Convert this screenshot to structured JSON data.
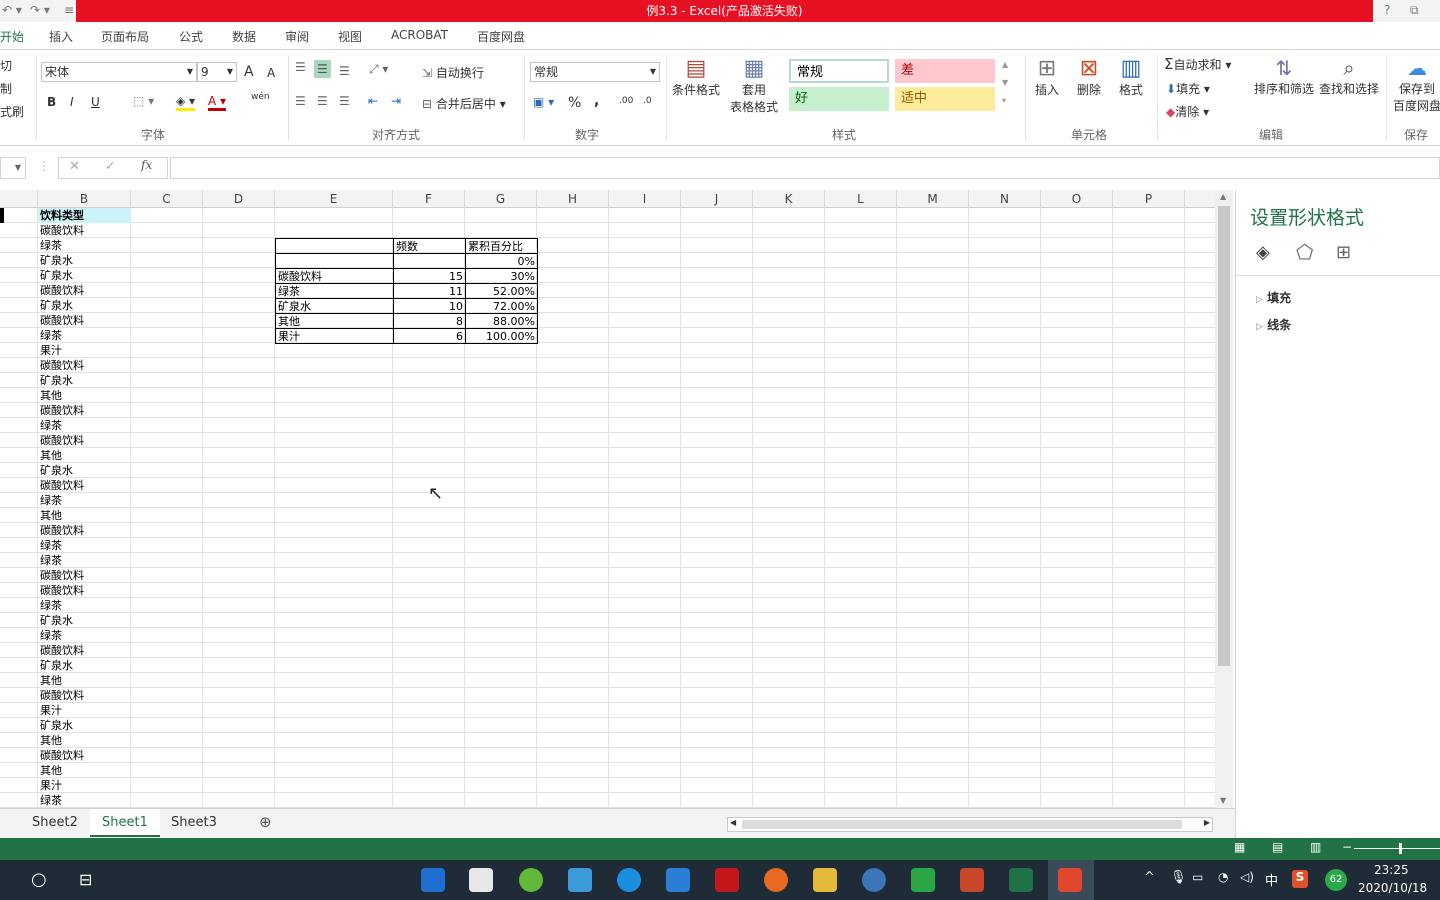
{
  "title": "例3.3 -  Excel(产品激活失败)",
  "window_buttons": {
    "help": "?",
    "restore": "⧉"
  },
  "tabs": [
    {
      "label": "开始",
      "active": true
    },
    {
      "label": "插入"
    },
    {
      "label": "页面布局"
    },
    {
      "label": "公式"
    },
    {
      "label": "数据"
    },
    {
      "label": "审阅"
    },
    {
      "label": "视图"
    },
    {
      "label": "ACROBAT"
    },
    {
      "label": "百度网盘"
    }
  ],
  "ribbon": {
    "clipboard": {
      "cut": "切",
      "copy": "制",
      "painter": "式刷"
    },
    "font": {
      "name": "宋体",
      "size": "9",
      "label": "字体",
      "bold": "B",
      "italic": "I",
      "underline": "U",
      "grow": "A",
      "shrink": "A",
      "phonetic": "wén"
    },
    "alignment": {
      "wrap": "自动换行",
      "merge": "合并后居中",
      "label": "对齐方式"
    },
    "number": {
      "format": "常规",
      "percent": "%",
      "comma": ",",
      "inc": ".00",
      "dec": ".0",
      "label": "数字"
    },
    "styles": {
      "conditional": "条件格式",
      "table_a": "套用",
      "table_b": "表格格式",
      "normal": "常规",
      "bad": "差",
      "good": "好",
      "neutral": "适中",
      "label": "样式"
    },
    "cells": {
      "insert": "插入",
      "delete": "删除",
      "format": "格式",
      "label": "单元格"
    },
    "editing": {
      "autosum": "自动求和",
      "fill": "填充",
      "clear": "清除",
      "sort": "排序和筛选",
      "find": "查找和选择",
      "label": "编辑"
    },
    "save": {
      "line1": "保存到",
      "line2": "百度网盘",
      "label": "保存"
    }
  },
  "formula_bar": {
    "fx": "fx",
    "cancel": "✕",
    "enter": "✓",
    "value": ""
  },
  "columns": [
    "B",
    "C",
    "D",
    "E",
    "F",
    "G",
    "H",
    "I",
    "J",
    "K",
    "L",
    "M",
    "N",
    "O",
    "P"
  ],
  "column_b": [
    "饮料类型",
    "碳酸饮料",
    "绿茶",
    "矿泉水",
    "矿泉水",
    "碳酸饮料",
    "矿泉水",
    "碳酸饮料",
    "绿茶",
    "果汁",
    "碳酸饮料",
    "矿泉水",
    "其他",
    "碳酸饮料",
    "绿茶",
    "碳酸饮料",
    "其他",
    "矿泉水",
    "碳酸饮料",
    "绿茶",
    "其他",
    "碳酸饮料",
    "绿茶",
    "绿茶",
    "碳酸饮料",
    "碳酸饮料",
    "绿茶",
    "矿泉水",
    "绿茶",
    "碳酸饮料",
    "矿泉水",
    "其他",
    "碳酸饮料",
    "果汁",
    "矿泉水",
    "其他",
    "碳酸饮料",
    "其他",
    "果汁",
    "绿茶"
  ],
  "freq_table": {
    "headers": [
      "",
      "频数",
      "累积百分比"
    ],
    "rows": [
      [
        "",
        "",
        "0%"
      ],
      [
        "碳酸饮料",
        "15",
        "30%"
      ],
      [
        "绿茶",
        "11",
        "52.00%"
      ],
      [
        "矿泉水",
        "10",
        "72.00%"
      ],
      [
        "其他",
        "8",
        "88.00%"
      ],
      [
        "果汁",
        "6",
        "100.00%"
      ]
    ]
  },
  "pane": {
    "title": "设置形状格式",
    "sections": [
      "填充",
      "线条"
    ]
  },
  "sheets": [
    {
      "label": "Sheet2"
    },
    {
      "label": "Sheet1",
      "active": true
    },
    {
      "label": "Sheet3"
    }
  ],
  "taskbar": {
    "time": "23:25",
    "date": "2020/10/18",
    "ime": "中",
    "badge": "62"
  },
  "colors": {
    "accent": "#217346",
    "titlebar": "#e81123",
    "bad_bg": "#ffc7ce",
    "good_bg": "#c6efce",
    "neutral_bg": "#ffeb9c"
  }
}
